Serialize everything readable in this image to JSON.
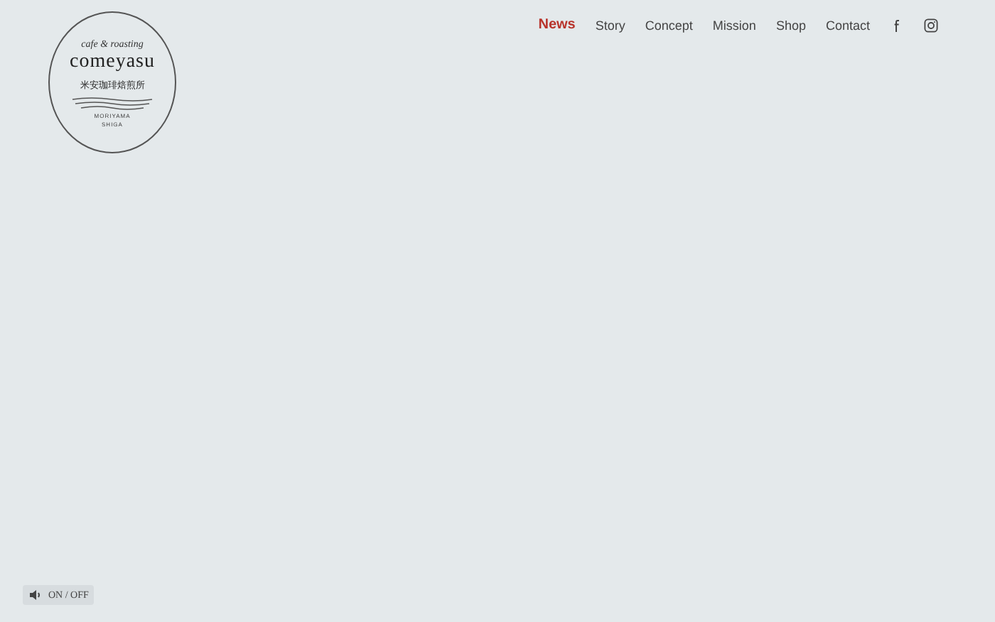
{
  "logo": {
    "tagline": "cafe & roasting",
    "name": "comeyasu",
    "subtitle": "米安珈琲焙煎所",
    "place_1": "MORIYAMA",
    "place_2": "SHIGA"
  },
  "nav": [
    {
      "label": "News",
      "selected": true
    },
    {
      "label": "Story",
      "selected": false
    },
    {
      "label": "Concept",
      "selected": false
    },
    {
      "label": "Mission",
      "selected": false
    },
    {
      "label": "Shop",
      "selected": false
    },
    {
      "label": "Contact",
      "selected": false
    }
  ],
  "sound_toggle": {
    "label": "ON / OFF"
  }
}
